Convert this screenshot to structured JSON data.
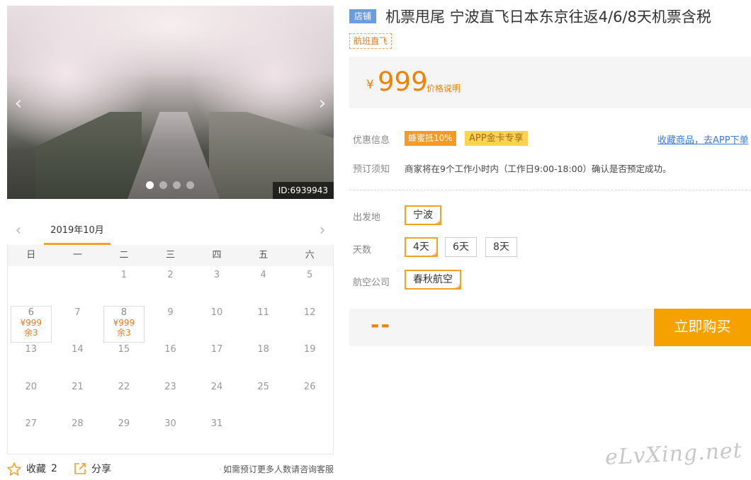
{
  "gallery": {
    "image_id": "ID:6939943",
    "slide_count": 4,
    "active_slide": 1
  },
  "calendar": {
    "month": "2019年10月",
    "weekdays": [
      "日",
      "一",
      "二",
      "三",
      "四",
      "五",
      "六"
    ],
    "weeks": [
      [
        null,
        null,
        {
          "day": "1"
        },
        {
          "day": "2"
        },
        {
          "day": "3"
        },
        {
          "day": "4"
        },
        {
          "day": "5"
        }
      ],
      [
        {
          "day": "6",
          "price": "¥999",
          "remain": "余3"
        },
        {
          "day": "7"
        },
        {
          "day": "8",
          "price": "¥999",
          "remain": "余3"
        },
        {
          "day": "9"
        },
        {
          "day": "10"
        },
        {
          "day": "11"
        },
        {
          "day": "12"
        }
      ],
      [
        {
          "day": "13"
        },
        {
          "day": "14"
        },
        {
          "day": "15"
        },
        {
          "day": "16"
        },
        {
          "day": "17"
        },
        {
          "day": "18"
        },
        {
          "day": "19"
        }
      ],
      [
        {
          "day": "20"
        },
        {
          "day": "21"
        },
        {
          "day": "22"
        },
        {
          "day": "23"
        },
        {
          "day": "24"
        },
        {
          "day": "25"
        },
        {
          "day": "26"
        }
      ],
      [
        {
          "day": "27"
        },
        {
          "day": "28"
        },
        {
          "day": "29"
        },
        {
          "day": "30"
        },
        {
          "day": "31"
        },
        null,
        null
      ]
    ]
  },
  "actions": {
    "favorite_label": "收藏",
    "favorite_count": "2",
    "share_label": "分享",
    "consult_note": "如需预订更多人数请咨询客服"
  },
  "product": {
    "shop_badge": "店铺",
    "title": "机票甩尾 宁波直飞日本东京往返4/6/8天机票含税",
    "tag": "航班直飞",
    "currency": "¥",
    "price": "999",
    "price_explain": "价格说明"
  },
  "info": {
    "promo_label": "优惠信息",
    "promo_tag_1": "蜂蜜抵10%",
    "promo_tag_2": "APP金卡专享",
    "favorite_link": "收藏商品，去APP下单",
    "notice_label": "预订须知",
    "notice_text": "商家将在9个工作小时内（工作日9:00-18:00）确认是否预定成功。"
  },
  "options": {
    "departure_label": "出发地",
    "departure_values": [
      "宁波"
    ],
    "days_label": "天数",
    "days_values": [
      "4天",
      "6天",
      "8天"
    ],
    "airline_label": "航空公司",
    "airline_values": [
      "春秋航空"
    ]
  },
  "purchase": {
    "total": "--",
    "buy_label": "立即购买"
  },
  "watermark": "eLvXing.net",
  "colors": {
    "accent": "#f5a100",
    "price": "#f08200",
    "link": "#3a7bd5",
    "shop_badge": "#6c9cdf"
  }
}
